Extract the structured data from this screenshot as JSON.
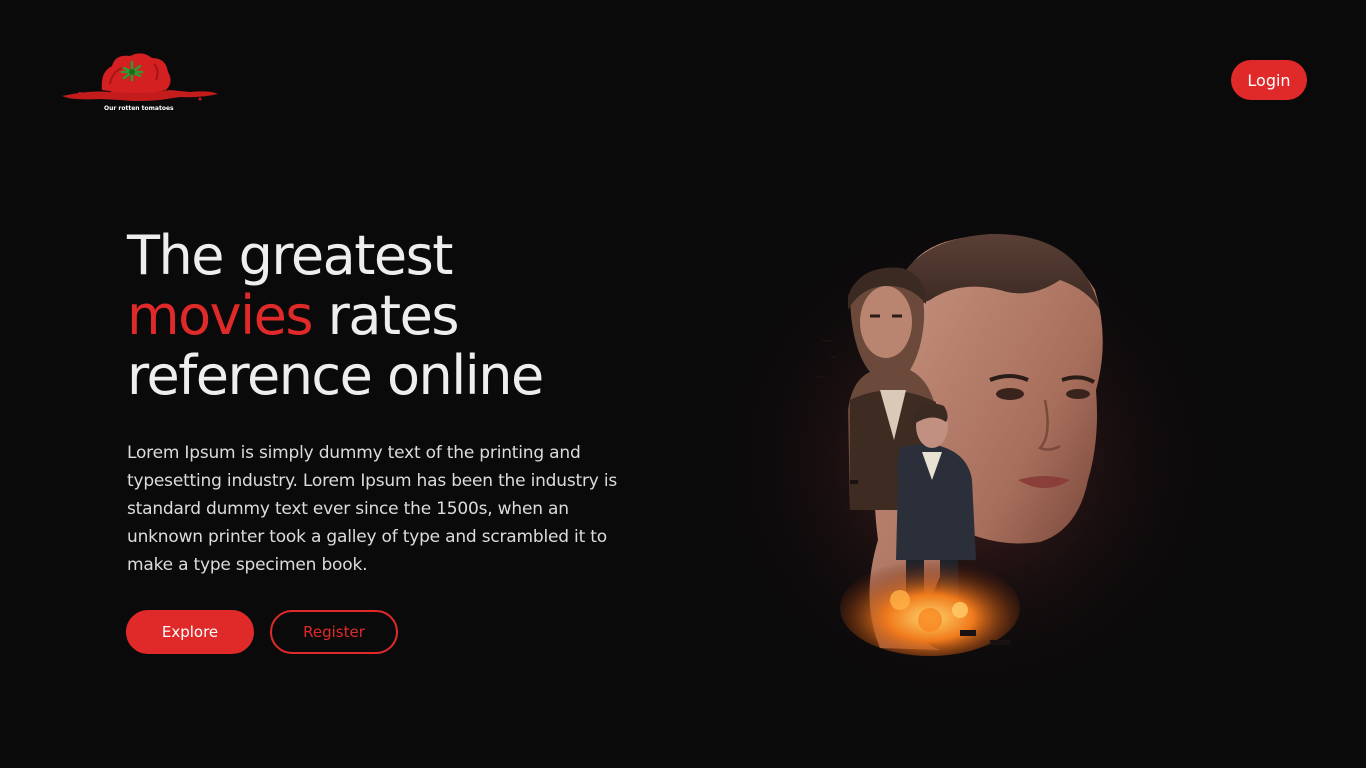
{
  "header": {
    "logo_text": "Our rotten tomatoes",
    "login_label": "Login"
  },
  "hero": {
    "title_line1": "The greatest",
    "title_accent": "movies",
    "title_line2_rest": " rates",
    "title_line3": "reference online",
    "description": "Lorem Ipsum is simply dummy text of the printing and typesetting industry. Lorem Ipsum has been the industry is standard dummy text ever since the 1500s, when an unknown printer took a galley of type and scrambled it to make a type specimen book.",
    "explore_label": "Explore",
    "register_label": "Register"
  },
  "colors": {
    "background": "#0b0a0b",
    "accent": "#e02a2a",
    "text": "#eeeeee"
  },
  "icons": {
    "logo": "tomato-splat-icon"
  }
}
